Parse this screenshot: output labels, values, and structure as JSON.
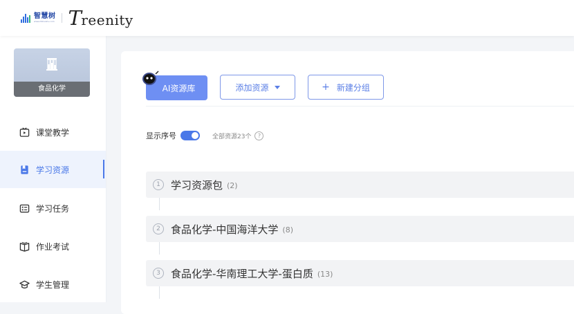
{
  "header": {
    "logo_cn": "智慧树",
    "logo_sub": "www.zhihuishu.com",
    "brand_initial": "T",
    "brand_rest": "reenity"
  },
  "sidebar": {
    "course_name": "食品化学",
    "items": [
      {
        "label": "课堂教学",
        "icon": "tv-icon",
        "active": false
      },
      {
        "label": "学习资源",
        "icon": "bookmark-icon",
        "active": true
      },
      {
        "label": "学习任务",
        "icon": "task-list-icon",
        "active": false
      },
      {
        "label": "作业考试",
        "icon": "book-icon",
        "active": false
      },
      {
        "label": "学生管理",
        "icon": "graduation-cap-icon",
        "active": false
      }
    ]
  },
  "toolbar": {
    "ai_label": "AI资源库",
    "add_label": "添加资源",
    "new_group_plus": "+",
    "new_group_label": "新建分组"
  },
  "order": {
    "label": "显示序号",
    "enabled": true,
    "total": "全部资源23个",
    "help": "?"
  },
  "groups": [
    {
      "num": "1",
      "title": "学习资源包",
      "count": "(2)"
    },
    {
      "num": "2",
      "title": "食品化学-中国海洋大学",
      "count": "(8)"
    },
    {
      "num": "3",
      "title": "食品化学-华南理工大学-蛋白质",
      "count": "(13)"
    }
  ],
  "colors": {
    "accent": "#4a78e8",
    "ai_button": "#6e8ff3",
    "active_bg": "#eef3fd"
  }
}
